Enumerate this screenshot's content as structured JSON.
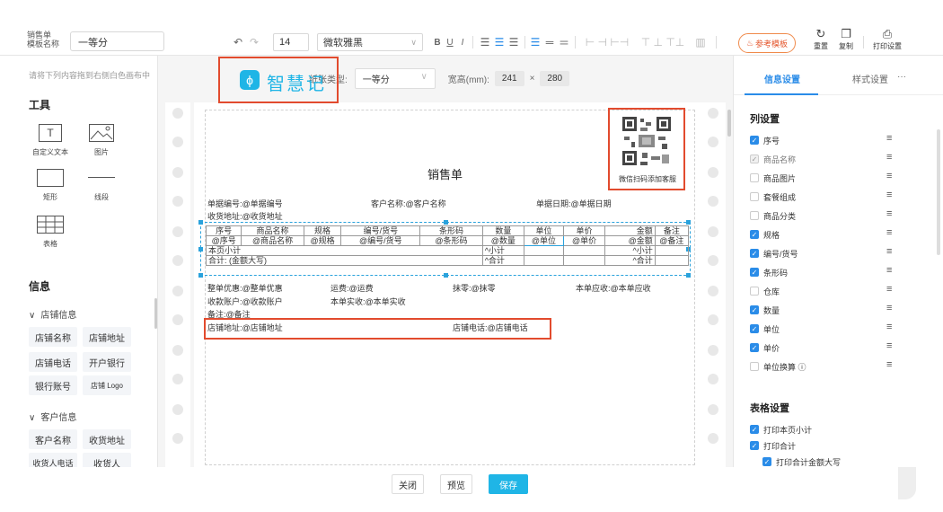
{
  "toolbar": {
    "template_label_1": "销售单",
    "template_label_2": "模板名称",
    "template_name": "一等分",
    "undo": "↶",
    "redo": "↷",
    "font_size": "14",
    "font_family": "微软雅黑",
    "bold": "B",
    "underline": "U",
    "italic": "I",
    "ref_template": "参考模板",
    "reset": "重置",
    "copy": "复制",
    "print_settings": "打印设置"
  },
  "left": {
    "hint": "请将下列内容拖到右侧白色画布中",
    "tools_title": "工具",
    "tools": [
      "自定义文本",
      "图片",
      "矩形",
      "线段",
      "表格"
    ],
    "info_title": "信息",
    "shop_group": "店铺信息",
    "shop_chips": [
      "店铺名称",
      "店铺地址",
      "店铺电话",
      "开户银行",
      "银行账号",
      "店铺 Logo"
    ],
    "customer_group": "客户信息",
    "customer_chips": [
      "客户名称",
      "收货地址",
      "收货人电话",
      "收货人"
    ]
  },
  "canvas": {
    "paper_type_label": "纸张类型:",
    "paper_type": "一等分",
    "size_label": "宽高(mm):",
    "width": "241",
    "times": "×",
    "height": "280",
    "logo_text": "智慧记",
    "qr_caption": "微信扫码添加客服",
    "doc_title": "销售单",
    "bill_no": "单据编号:@单据编号",
    "customer": "客户名称:@客户名称",
    "bill_date": "单据日期:@单据日期",
    "ship_addr": "收货地址:@收货地址",
    "headers": [
      "序号",
      "商品名称",
      "规格",
      "编号/货号",
      "条形码",
      "数量",
      "单位",
      "单价",
      "金额",
      "备注"
    ],
    "row": [
      "@序号",
      "@商品名称",
      "@规格",
      "@编号/货号",
      "@条形码",
      "@数量",
      "@单位",
      "@单价",
      "@金额",
      "@备注"
    ],
    "subtotal_label": "本页小计",
    "subtotal_qty": "^小计",
    "subtotal_amt": "^小计",
    "total_label": "合计: (金额大写)",
    "total_qty": "^合计",
    "total_amt": "^合计",
    "discount": "整单优惠:@整单优惠",
    "freight": "运费:@运费",
    "rounding": "抹零:@抹零",
    "receivable": "本单应收:@本单应收",
    "account": "收款账户:@收款账户",
    "actual": "本单实收:@本单实收",
    "remark": "备注:@备注",
    "shop_addr": "店铺地址:@店铺地址",
    "shop_phone": "店铺电话:@店铺电话"
  },
  "right": {
    "tab_info": "信息设置",
    "tab_style": "样式设置",
    "more": "···",
    "columns_title": "列设置",
    "columns": [
      {
        "label": "序号",
        "state": "on"
      },
      {
        "label": "商品名称",
        "state": "dis"
      },
      {
        "label": "商品图片",
        "state": "off"
      },
      {
        "label": "套餐组成",
        "state": "off"
      },
      {
        "label": "商品分类",
        "state": "off"
      },
      {
        "label": "规格",
        "state": "on"
      },
      {
        "label": "编号/货号",
        "state": "on"
      },
      {
        "label": "条形码",
        "state": "on"
      },
      {
        "label": "仓库",
        "state": "off"
      },
      {
        "label": "数量",
        "state": "on"
      },
      {
        "label": "单位",
        "state": "on"
      },
      {
        "label": "单价",
        "state": "on"
      },
      {
        "label": "单位换算 ⓘ",
        "state": "off"
      }
    ],
    "table_title": "表格设置",
    "table_opts": [
      {
        "label": "打印本页小计",
        "state": "on"
      },
      {
        "label": "打印合计",
        "state": "on"
      },
      {
        "label": "打印合计金额大写",
        "state": "on"
      }
    ]
  },
  "bottom": {
    "close": "关闭",
    "preview": "预览",
    "save": "保存"
  },
  "colors": {
    "accent": "#2a8ce8",
    "brand": "#1fb5e6",
    "highlight": "#e24b2e"
  }
}
